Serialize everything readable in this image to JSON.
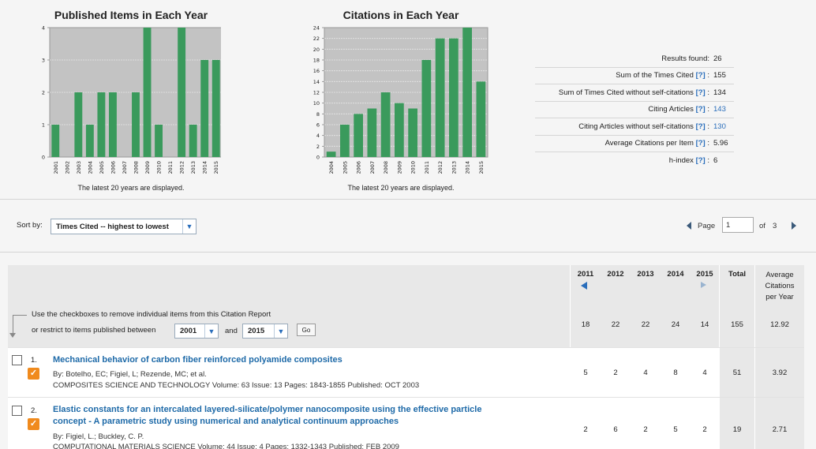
{
  "charts": {
    "published": {
      "title": "Published Items in Each Year",
      "note": "The latest 20 years are displayed."
    },
    "citations": {
      "title": "Citations in Each Year",
      "note": "The latest 20 years are displayed."
    }
  },
  "chart_data": [
    {
      "type": "bar",
      "title": "Published Items in Each Year",
      "categories": [
        "2001",
        "2002",
        "2003",
        "2004",
        "2005",
        "2006",
        "2007",
        "2008",
        "2009",
        "2010",
        "2011",
        "2012",
        "2013",
        "2014",
        "2015"
      ],
      "values": [
        1,
        0,
        2,
        1,
        2,
        2,
        0,
        2,
        4,
        1,
        0,
        4,
        1,
        3,
        3
      ],
      "ylim": [
        0,
        4
      ],
      "yticks": [
        0,
        1,
        2,
        3,
        4
      ],
      "grid": true,
      "color": "#3a9a5c"
    },
    {
      "type": "bar",
      "title": "Citations in Each Year",
      "categories": [
        "2004",
        "2005",
        "2006",
        "2007",
        "2008",
        "2009",
        "2010",
        "2011",
        "2012",
        "2013",
        "2014",
        "2015"
      ],
      "values": [
        1,
        6,
        8,
        9,
        12,
        10,
        9,
        18,
        22,
        22,
        24,
        14
      ],
      "ylim": [
        0,
        24
      ],
      "yticks": [
        0,
        2,
        4,
        6,
        8,
        10,
        12,
        14,
        16,
        18,
        20,
        22,
        24
      ],
      "grid": true,
      "color": "#3a9a5c"
    }
  ],
  "stats": {
    "results_found_label": "Results found:",
    "results_found": "26",
    "sum_times_cited_label": "Sum of the Times Cited",
    "sum_times_cited": "155",
    "sum_without_self_label": "Sum of Times Cited without self-citations",
    "sum_without_self": "134",
    "citing_articles_label": "Citing Articles",
    "citing_articles": "143",
    "citing_without_self_label": "Citing Articles without self-citations",
    "citing_without_self": "130",
    "avg_citations_label": "Average Citations per Item",
    "avg_citations": "5.96",
    "h_index_label": "h-index",
    "h_index": "6",
    "help": "[?]",
    "colon": ":"
  },
  "sort": {
    "label": "Sort by:",
    "value": "Times Cited -- highest to lowest"
  },
  "pager": {
    "page_label": "Page",
    "page_value": "1",
    "of_label": "of",
    "total_pages": "3"
  },
  "filter": {
    "line1": "Use the checkboxes to remove individual items from this Citation Report",
    "line2": "or restrict to items published between",
    "from_year": "2001",
    "and_label": "and",
    "to_year": "2015",
    "go_label": "Go"
  },
  "table": {
    "year_headers": [
      "2011",
      "2012",
      "2013",
      "2014",
      "2015"
    ],
    "total_header": "Total",
    "avg_header": [
      "Average",
      "Citations",
      "per Year"
    ],
    "summary": [
      "18",
      "22",
      "22",
      "24",
      "14",
      "155",
      "12.92"
    ],
    "rows": [
      {
        "number": "1.",
        "title_lines": [
          "Mechanical behavior of carbon fiber reinforced polyamide composites"
        ],
        "authors": "By: Botelho, EC; Figiel, L; Rezende, MC; et al.",
        "source": "COMPOSITES SCIENCE AND TECHNOLOGY  Volume: 63   Issue: 13   Pages: 1843-1855   Published: OCT 2003",
        "values": [
          "5",
          "2",
          "4",
          "8",
          "4"
        ],
        "total": "51",
        "avg": "3.92"
      },
      {
        "number": "2.",
        "title_lines": [
          "Elastic constants for an intercalated layered-silicate/polymer nanocomposite using the effective particle",
          "concept - A parametric study using numerical and analytical continuum approaches"
        ],
        "authors": "By: Figiel, L.; Buckley, C. P.",
        "source": "COMPUTATIONAL MATERIALS SCIENCE  Volume: 44   Issue: 4   Pages: 1332-1343   Published: FEB 2009",
        "values": [
          "2",
          "6",
          "2",
          "5",
          "2"
        ],
        "total": "19",
        "avg": "2.71"
      }
    ]
  }
}
